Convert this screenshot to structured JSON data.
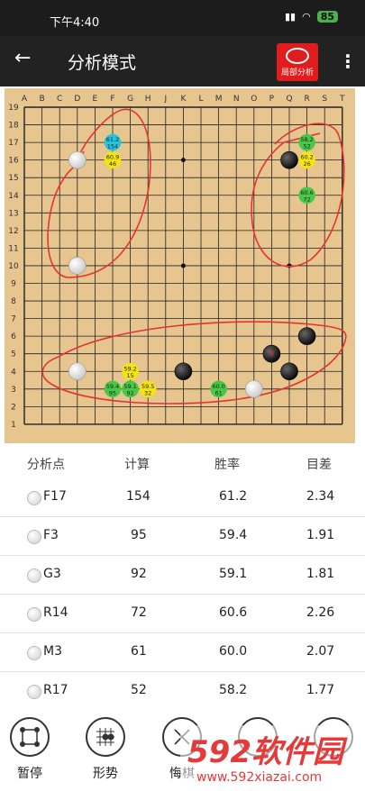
{
  "statusbar": {
    "time": "下午4:40",
    "battery": "85"
  },
  "appbar": {
    "back_glyph": "←",
    "title": "分析模式",
    "local_analysis_label": "局部分析",
    "more_glyph": "⋮"
  },
  "board": {
    "columns": [
      "A",
      "B",
      "C",
      "D",
      "E",
      "F",
      "G",
      "H",
      "J",
      "K",
      "L",
      "M",
      "N",
      "O",
      "P",
      "Q",
      "R",
      "S",
      "T"
    ],
    "rows": [
      "19",
      "18",
      "17",
      "16",
      "15",
      "14",
      "13",
      "12",
      "11",
      "10",
      "9",
      "8",
      "7",
      "6",
      "5",
      "4",
      "3",
      "2",
      "1"
    ],
    "stones": [
      {
        "coord": "D16",
        "color": "white"
      },
      {
        "coord": "Q16",
        "color": "black"
      },
      {
        "coord": "D10",
        "color": "white"
      },
      {
        "coord": "R6",
        "color": "black"
      },
      {
        "coord": "P5",
        "color": "black",
        "label": "9"
      },
      {
        "coord": "Q4",
        "color": "black"
      },
      {
        "coord": "D4",
        "color": "white"
      },
      {
        "coord": "K4",
        "color": "black"
      },
      {
        "coord": "O3",
        "color": "white"
      }
    ],
    "star_points": [
      "K16",
      "K10",
      "Q10"
    ],
    "candidates": [
      {
        "coord": "F17",
        "color": "#23c6e0",
        "winrate": "61.2",
        "playouts": "154"
      },
      {
        "coord": "F16",
        "color": "#f5e50a",
        "winrate": "60.9",
        "playouts": "46"
      },
      {
        "coord": "R17",
        "color": "#47c947",
        "winrate": "58.2",
        "playouts": "52"
      },
      {
        "coord": "R16",
        "color": "#f5e50a",
        "winrate": "60.2",
        "playouts": "26"
      },
      {
        "coord": "R14",
        "color": "#47c947",
        "winrate": "60.6",
        "playouts": "72"
      },
      {
        "coord": "G4",
        "color": "#f5e50a",
        "winrate": "59.2",
        "playouts": "15"
      },
      {
        "coord": "F3",
        "color": "#47c947",
        "winrate": "59.4",
        "playouts": "95"
      },
      {
        "coord": "G3",
        "color": "#47c947",
        "winrate": "59.1",
        "playouts": "92"
      },
      {
        "coord": "H3",
        "color": "#f5e50a",
        "winrate": "59.5",
        "playouts": "32"
      },
      {
        "coord": "M3",
        "color": "#47c947",
        "winrate": "60.0",
        "playouts": "61"
      }
    ]
  },
  "table": {
    "headers": {
      "point": "分析点",
      "playouts": "计算",
      "winrate": "胜率",
      "score": "目差"
    },
    "rows": [
      {
        "point": "F17",
        "playouts": "154",
        "winrate": "61.2",
        "score": "2.34"
      },
      {
        "point": "F3",
        "playouts": "95",
        "winrate": "59.4",
        "score": "1.91"
      },
      {
        "point": "G3",
        "playouts": "92",
        "winrate": "59.1",
        "score": "1.81"
      },
      {
        "point": "R14",
        "playouts": "72",
        "winrate": "60.6",
        "score": "2.26"
      },
      {
        "point": "M3",
        "playouts": "61",
        "winrate": "60.0",
        "score": "2.07"
      },
      {
        "point": "R17",
        "playouts": "52",
        "winrate": "58.2",
        "score": "1.77"
      }
    ]
  },
  "toolbar": {
    "pause_label": "暂停",
    "shape_label": "形势",
    "undo_label": "悔棋"
  },
  "watermark": {
    "brand": "592软件园",
    "url": "www.592xiazai.com"
  },
  "colors": {
    "board": "#e6c58f",
    "annotation": "#e53333",
    "accent": "#e01c1c"
  }
}
